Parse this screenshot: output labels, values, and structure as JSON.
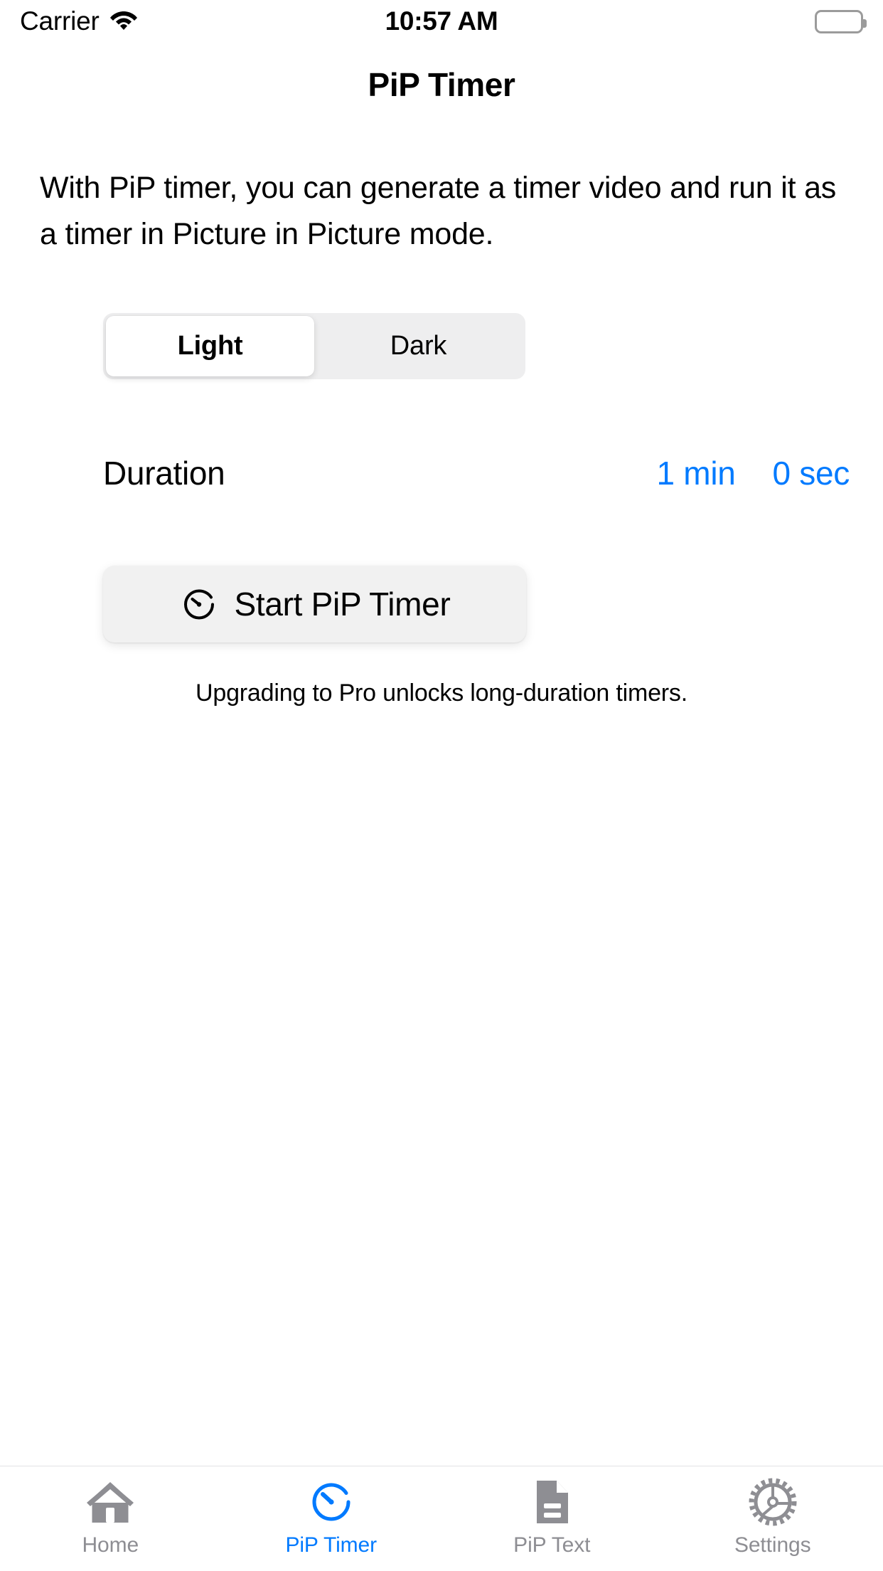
{
  "status_bar": {
    "carrier": "Carrier",
    "wifi_icon": "wifi-icon",
    "time": "10:57 AM",
    "battery_icon": "battery-full-icon"
  },
  "header": {
    "title": "PiP Timer"
  },
  "main": {
    "description": "With PiP timer, you can generate a timer video and run it as a timer in Picture in Picture mode.",
    "appearance_segmented": {
      "selected": "Light",
      "options": [
        {
          "label": "Light",
          "selected": true
        },
        {
          "label": "Dark",
          "selected": false
        }
      ]
    },
    "duration": {
      "label": "Duration",
      "minutes_value": "1 min",
      "seconds_value": "0 sec"
    },
    "start_button": {
      "label": "Start PiP Timer",
      "icon": "stopwatch-icon"
    },
    "footnote": "Upgrading to Pro unlocks long-duration timers."
  },
  "tab_bar": {
    "items": [
      {
        "label": "Home",
        "icon": "house-icon",
        "active": false
      },
      {
        "label": "PiP Timer",
        "icon": "stopwatch-icon",
        "active": true
      },
      {
        "label": "PiP Text",
        "icon": "document-icon",
        "active": false
      },
      {
        "label": "Settings",
        "icon": "gear-icon",
        "active": false
      }
    ]
  },
  "colors": {
    "accent": "#007AFF",
    "inactive": "#8E8E93",
    "segment_track": "#EEEEEF",
    "button_fill": "#F1F1F1"
  }
}
